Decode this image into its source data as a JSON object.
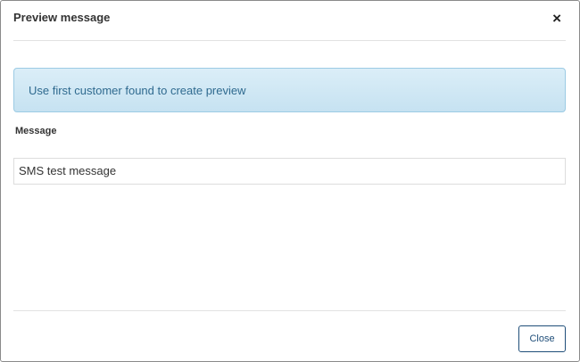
{
  "dialog": {
    "title": "Preview message",
    "close_icon": "×"
  },
  "info_alert": {
    "text": "Use first customer found to create preview"
  },
  "message": {
    "label": "Message",
    "value": "SMS test message"
  },
  "footer": {
    "close_label": "Close"
  }
}
